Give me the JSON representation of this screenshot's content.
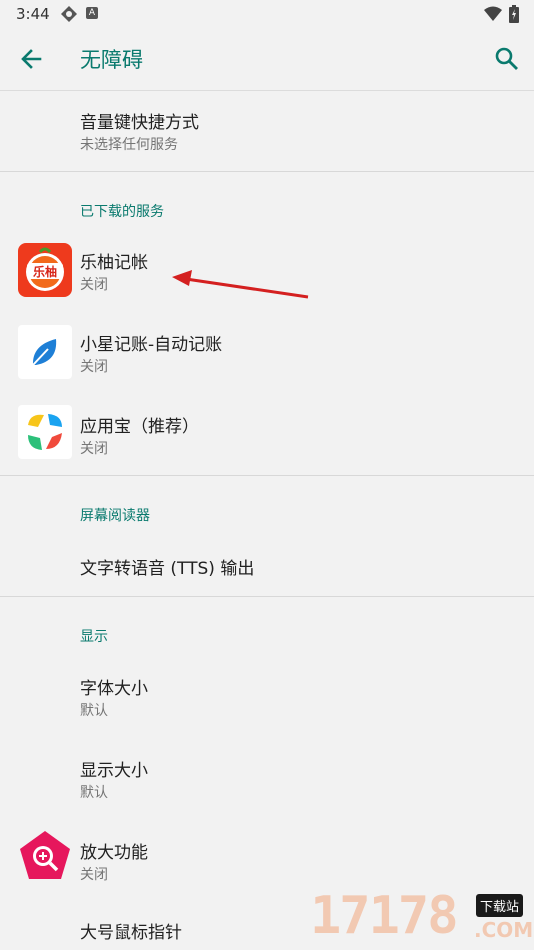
{
  "status_bar": {
    "time": "3:44",
    "badge_letter": "A"
  },
  "app_bar": {
    "title": "无障碍",
    "back_icon": "arrow-back-icon",
    "search_icon": "search-icon"
  },
  "shortcut": {
    "title": "音量键快捷方式",
    "subtitle": "未选择任何服务"
  },
  "downloaded": {
    "header": "已下载的服务",
    "items": [
      {
        "title": "乐柚记帐",
        "subtitle": "关闭",
        "icon": "leyou-app-icon",
        "icon_text": "乐柚"
      },
      {
        "title": "小星记账-自动记账",
        "subtitle": "关闭",
        "icon": "leaf-app-icon"
      },
      {
        "title": "应用宝（推荐）",
        "subtitle": "关闭",
        "icon": "yingyongbao-app-icon"
      }
    ]
  },
  "screen_reader": {
    "header": "屏幕阅读器",
    "tts": "文字转语音 (TTS) 输出"
  },
  "display": {
    "header": "显示",
    "font_size": {
      "title": "字体大小",
      "subtitle": "默认"
    },
    "display_size": {
      "title": "显示大小",
      "subtitle": "默认"
    },
    "magnification": {
      "title": "放大功能",
      "subtitle": "关闭",
      "icon": "magnify-app-icon"
    },
    "large_pointer": {
      "title": "大号鼠标指针"
    }
  },
  "watermark": {
    "text": "17178",
    "badge": "下载站",
    "suffix": ".COM"
  },
  "colors": {
    "accent": "#0a7a6e",
    "background": "#f2f2f2",
    "annotation_arrow": "#d42020"
  }
}
